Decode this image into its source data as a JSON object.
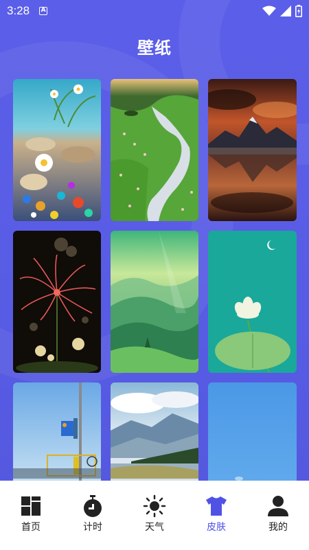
{
  "status_bar": {
    "time": "3:28",
    "notif_letter": "A",
    "icons": [
      "wifi-icon",
      "signal-icon",
      "battery-icon"
    ]
  },
  "header": {
    "title": "壁纸"
  },
  "colors": {
    "accent": "#5052e6",
    "background": "#5a5de6",
    "nav_text": "#222222"
  },
  "wallpapers": [
    {
      "name": "daisies-beach",
      "theme": "daisies on a pebble beach"
    },
    {
      "name": "mountain-stream",
      "theme": "green meadow stream"
    },
    {
      "name": "mountain-lake-sunset",
      "theme": "mountain lake at sunset"
    },
    {
      "name": "red-spider-lily",
      "theme": "red spider lily at night"
    },
    {
      "name": "green-misty-hills",
      "theme": "green misty hills"
    },
    {
      "name": "white-lotus",
      "theme": "white lotus on teal with moon"
    },
    {
      "name": "street-signal",
      "theme": "traffic signal pole under blue sky"
    },
    {
      "name": "cloudy-mountains",
      "theme": "clouds over mountains and forest"
    },
    {
      "name": "blue-sky",
      "theme": "plain blue sky"
    }
  ],
  "nav": {
    "items": [
      {
        "label": "首页",
        "icon": "home-grid-icon",
        "active": false
      },
      {
        "label": "计时",
        "icon": "timer-icon",
        "active": false
      },
      {
        "label": "天气",
        "icon": "sun-icon",
        "active": false
      },
      {
        "label": "皮肤",
        "icon": "shirt-icon",
        "active": true
      },
      {
        "label": "我的",
        "icon": "user-icon",
        "active": false
      }
    ]
  }
}
